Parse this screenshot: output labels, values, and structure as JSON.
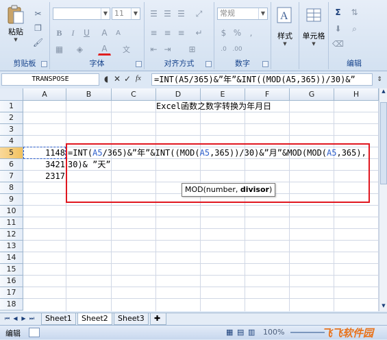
{
  "ribbon": {
    "clipboard": {
      "paste_label": "粘贴",
      "group_label": "剪贴板"
    },
    "font": {
      "font_name": "",
      "font_size": "11",
      "group_label": "字体",
      "bold": "B",
      "italic": "I",
      "underline": "U",
      "grow": "A",
      "shrink": "A",
      "font_color": "A",
      "wen": "文"
    },
    "alignment": {
      "group_label": "对齐方式"
    },
    "number": {
      "format": "常规",
      "group_label": "数字",
      "currency": "%",
      "comma": ",",
      "percent": "%"
    },
    "styles": {
      "label": "样式"
    },
    "cells": {
      "label": "单元格"
    },
    "editing": {
      "sigma": "Σ",
      "group_label": "编辑"
    }
  },
  "formula_bar": {
    "name_box": "TRANSPOSE",
    "cancel": "✕",
    "enter": "✓",
    "fx": "fx",
    "formula": "=INT(A5/365)&”年”&INT((MOD(A5,365))/30)&”"
  },
  "grid": {
    "columns": [
      "A",
      "B",
      "C",
      "D",
      "E",
      "F",
      "G",
      "H"
    ],
    "rows": [
      "1",
      "2",
      "3",
      "4",
      "5",
      "6",
      "7",
      "8",
      "9",
      "10",
      "11",
      "12",
      "13",
      "14",
      "15",
      "16",
      "17",
      "18"
    ],
    "title_text": "Excel函数之数字转换为年月日",
    "values": {
      "a5": "1148",
      "a6": "3421",
      "a7": "2317"
    },
    "edit_line1": {
      "p1": "=INT(",
      "r1": "A5",
      "p2": "/365)&”年”&INT((MOD(",
      "r2": "A5",
      "p3": ",365))/30)&”月”&MOD(MOD(",
      "r3": "A5",
      "p4": ",365),"
    },
    "edit_line2": "30)& ”天”",
    "tooltip": {
      "func": "MOD(number, ",
      "arg": "divisor",
      "close": ")"
    }
  },
  "sheets": {
    "tabs": [
      "Sheet1",
      "Sheet2",
      "Sheet3"
    ],
    "active": "Sheet2"
  },
  "status": {
    "mode": "编辑",
    "zoom": "100%",
    "watermark": "飞飞软件园"
  },
  "colors": {
    "accent_red": "#e0161f",
    "ref_blue": "#2c5ecb",
    "header_selected": "#f1c15f"
  }
}
